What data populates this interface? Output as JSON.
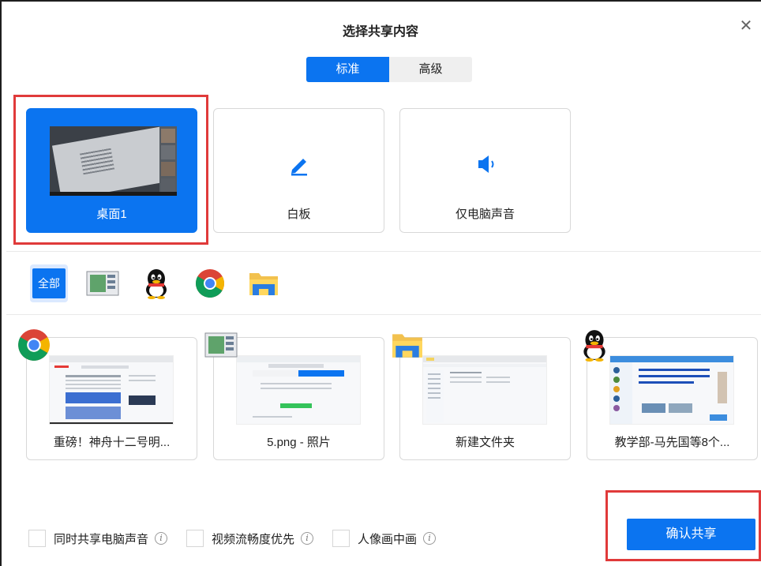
{
  "dialog": {
    "title": "选择共享内容"
  },
  "tabs": [
    {
      "label": "标准",
      "active": true
    },
    {
      "label": "高级",
      "active": false
    }
  ],
  "top_sources": [
    {
      "label": "桌面1",
      "selected": true,
      "icon": "desktop-thumbnail"
    },
    {
      "label": "白板",
      "selected": false,
      "icon": "pencil-icon"
    },
    {
      "label": "仅电脑声音",
      "selected": false,
      "icon": "speaker-icon"
    }
  ],
  "filters": {
    "all_label": "全部",
    "items": [
      "all",
      "photos-app-icon",
      "qq-icon",
      "chrome-icon",
      "file-explorer-icon"
    ]
  },
  "windows": [
    {
      "label": "重磅！神舟十二号明...",
      "app_icon": "chrome-icon"
    },
    {
      "label": "5.png - 照片",
      "app_icon": "photos-app-icon"
    },
    {
      "label": "新建文件夹",
      "app_icon": "file-explorer-icon"
    },
    {
      "label": "教学部-马先国等8个...",
      "app_icon": "qq-icon"
    }
  ],
  "options": [
    {
      "label": "同时共享电脑声音",
      "checked": false
    },
    {
      "label": "视频流畅度优先",
      "checked": false
    },
    {
      "label": "人像画中画",
      "checked": false
    }
  ],
  "confirm_label": "确认共享",
  "colors": {
    "accent": "#0b74f0",
    "highlight": "#e03a3a"
  }
}
